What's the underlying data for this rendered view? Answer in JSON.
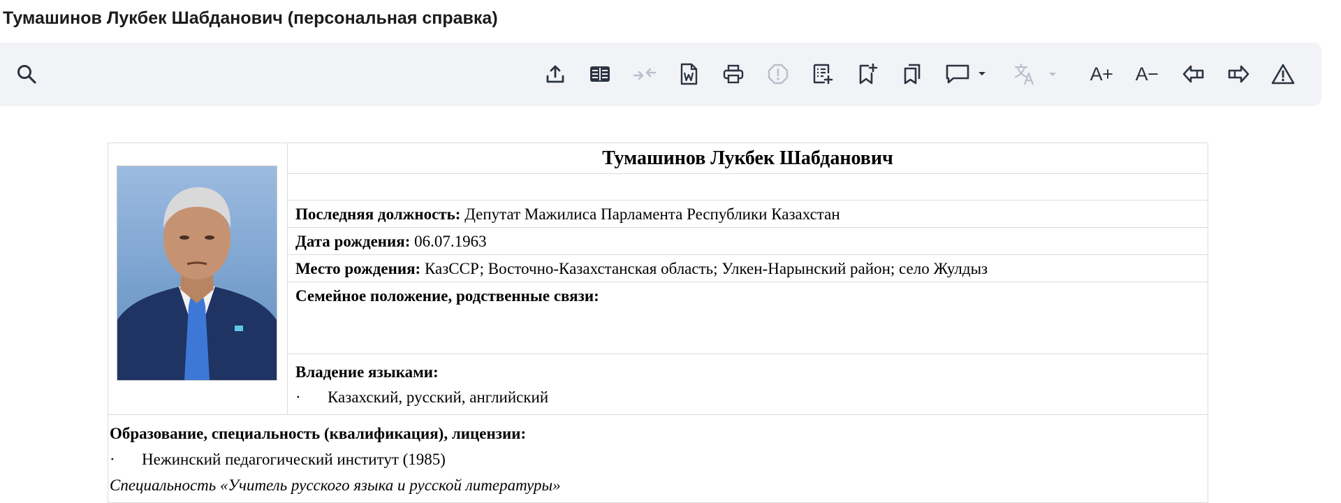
{
  "header": {
    "title": "Тумашинов Лукбек Шабданович (персональная справка)"
  },
  "toolbar": {
    "search_icon": "search-icon",
    "buttons": [
      {
        "name": "export-icon"
      },
      {
        "name": "reader-view-icon"
      },
      {
        "name": "collapse-icon"
      },
      {
        "name": "word-export-icon"
      },
      {
        "name": "print-icon"
      },
      {
        "name": "warning-octagon-icon"
      },
      {
        "name": "add-note-icon"
      },
      {
        "name": "add-bookmark-icon"
      },
      {
        "name": "bookmarks-icon"
      },
      {
        "name": "comment-icon"
      },
      {
        "name": "translate-icon"
      }
    ],
    "font_increase_label": "A+",
    "font_decrease_label": "A−",
    "back_icon": "back-arrow-icon",
    "forward_icon": "forward-arrow-icon",
    "report_icon": "alert-triangle-icon"
  },
  "document": {
    "name": "Тумашинов Лукбек Шабданович",
    "position_label": "Последняя должность:",
    "position_value": " Депутат Мажилиса Парламента Республики Казахстан",
    "birthdate_label": "Дата рождения:",
    "birthdate_value": " 06.07.1963",
    "birthplace_label": "Место рождения:",
    "birthplace_value": " КазССР; Восточно-Казахстанская область; Улкен-Нарынский район; село Жулдыз",
    "family_label": "Семейное положение, родственные связи:",
    "languages_label": "Владение языками:",
    "bullet": "·",
    "languages_value": "Казахский, русский, английский",
    "education_label": "Образование, специальность (квалификация), лицензии:",
    "education_item": "Нежинский педагогический институт (1985)",
    "specialty": "Специальность «Учитель русского языка и русской литературы»"
  },
  "colors": {
    "toolbar_bg": "#f1f3f7",
    "icon": "#2c3340",
    "icon_disabled": "#b9bfca",
    "border": "#dcdcdc"
  }
}
